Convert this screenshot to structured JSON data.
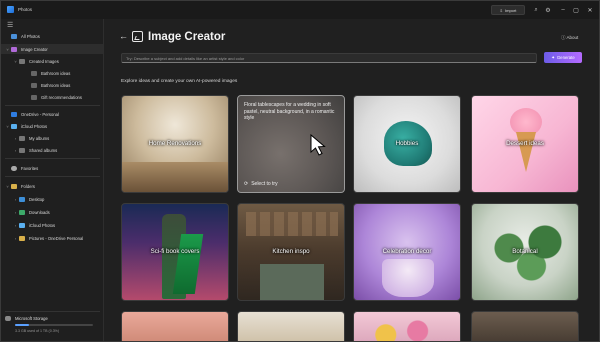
{
  "app": {
    "title": "Photos"
  },
  "titlebar": {
    "import_label": "Import",
    "search_icon": "search-icon",
    "settings_icon": "gear-icon"
  },
  "sidebar": {
    "items": [
      {
        "label": "All Photos"
      },
      {
        "label": "Image Creator"
      },
      {
        "label": "Created Images"
      },
      {
        "label": "Bathroom ideas"
      },
      {
        "label": "Bathroom ideas"
      },
      {
        "label": "Gift recommendations"
      },
      {
        "label": "OneDrive - Personal"
      },
      {
        "label": "iCloud Photos"
      },
      {
        "label": "My albums"
      },
      {
        "label": "Shared albums"
      },
      {
        "label": "Favorites"
      },
      {
        "label": "Folders"
      },
      {
        "label": "Desktop"
      },
      {
        "label": "Downloads"
      },
      {
        "label": "iCloud Photos"
      },
      {
        "label": "Pictures - OneDrive Personal"
      }
    ],
    "storage": {
      "title": "Microsoft Storage",
      "detail": "3.3 GB used of 1 TB (0.3%)",
      "used_fraction": 0.18
    }
  },
  "main": {
    "title": "Image Creator",
    "about": "About",
    "prompt_placeholder": "Try: Describe a subject and add details like an artist style and color",
    "generate": "Generate",
    "explore": "Explore ideas and create your own AI-powered images",
    "cards": [
      {
        "label": "Home Renovations"
      },
      {
        "label": "",
        "overlay_text": "Floral tablescapes for a wedding in soft pastel, neutral background, in a romantic style",
        "select": "Select to try"
      },
      {
        "label": "Hobbies"
      },
      {
        "label": "Dessert ideas"
      },
      {
        "label": "Sci-fi book covers"
      },
      {
        "label": "Kitchen inspo"
      },
      {
        "label": "Celebration decor"
      },
      {
        "label": "Botanical"
      }
    ]
  },
  "colors": {
    "accent": "#8b5cf6",
    "background": "#202020",
    "sidebar": "#1f1f1f"
  }
}
